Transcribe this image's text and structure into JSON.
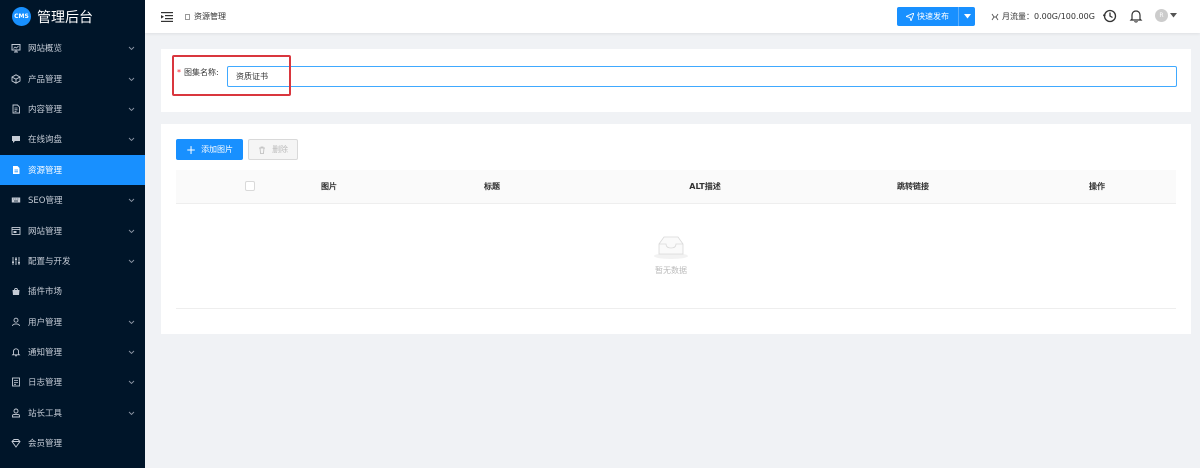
{
  "app": {
    "logo_badge": "CMS",
    "title": "管理后台"
  },
  "sidebar": {
    "items": [
      {
        "label": "网站概览",
        "icon": "monitor-icon",
        "has_chevron": true,
        "active": false
      },
      {
        "label": "产品管理",
        "icon": "cube-icon",
        "has_chevron": true,
        "active": false
      },
      {
        "label": "内容管理",
        "icon": "document-icon",
        "has_chevron": true,
        "active": false
      },
      {
        "label": "在线询盘",
        "icon": "chat-icon",
        "has_chevron": true,
        "active": false
      },
      {
        "label": "资源管理",
        "icon": "file-icon",
        "has_chevron": false,
        "active": true
      },
      {
        "label": "SEO管理",
        "icon": "keyboard-icon",
        "has_chevron": true,
        "active": false
      },
      {
        "label": "网站管理",
        "icon": "browser-icon",
        "has_chevron": true,
        "active": false
      },
      {
        "label": "配置与开发",
        "icon": "sliders-icon",
        "has_chevron": true,
        "active": false
      },
      {
        "label": "插件市场",
        "icon": "bag-icon",
        "has_chevron": false,
        "active": false
      },
      {
        "label": "用户管理",
        "icon": "user-icon",
        "has_chevron": true,
        "active": false
      },
      {
        "label": "通知管理",
        "icon": "bell-icon",
        "has_chevron": true,
        "active": false
      },
      {
        "label": "日志管理",
        "icon": "log-icon",
        "has_chevron": true,
        "active": false
      },
      {
        "label": "站长工具",
        "icon": "tool-user-icon",
        "has_chevron": true,
        "active": false
      },
      {
        "label": "会员管理",
        "icon": "diamond-icon",
        "has_chevron": false,
        "active": false
      }
    ]
  },
  "header": {
    "breadcrumb": "资源管理",
    "publish_label": "快速发布",
    "traffic_label": "月流量：0.00G/100.00G",
    "avatar_text": "R"
  },
  "form": {
    "label": "图集名称",
    "colon": ":",
    "value": "资质证书"
  },
  "toolbar": {
    "add_label": "添加图片",
    "delete_label": "删除"
  },
  "table": {
    "columns": [
      "图片",
      "标题",
      "ALT描述",
      "跳转链接",
      "操作"
    ],
    "empty_text": "暂无数据"
  },
  "colors": {
    "sidebar_bg": "#001529",
    "accent": "#1890ff",
    "highlight": "#d9363e"
  }
}
